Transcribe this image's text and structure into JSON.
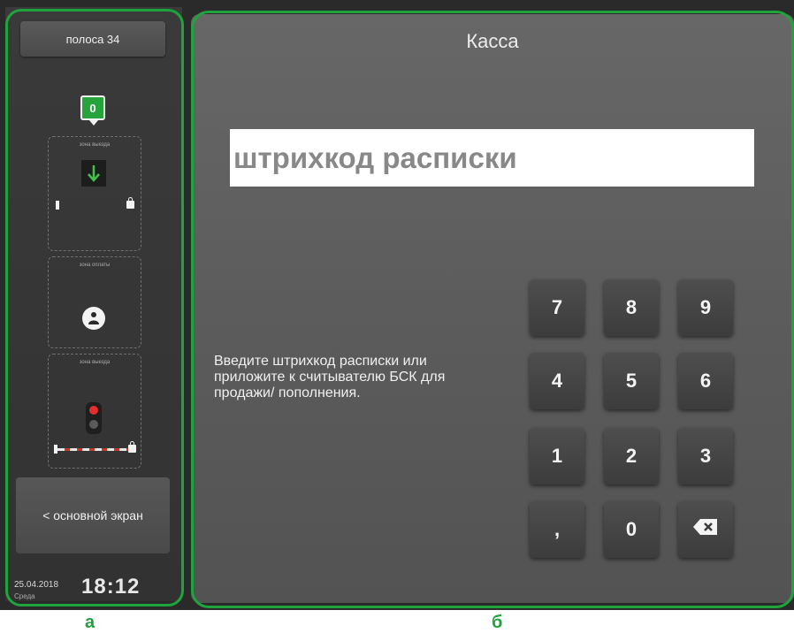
{
  "sidebar": {
    "lane_label": "полоса 34",
    "counter": "0",
    "zones": [
      "зона выезда",
      "зона оплаты",
      "зона выезда"
    ],
    "main_screen_label": "< основной экран",
    "date": "25.04.2018",
    "weekday": "Среда",
    "time": "18:12"
  },
  "panel": {
    "title": "Касса",
    "barcode_placeholder": "штрихкод расписки",
    "instruction": "Введите штрихкод расписки или приложите к считывателю БСК для продажи/ пополнения.",
    "keys": [
      "7",
      "8",
      "9",
      "4",
      "5",
      "6",
      "1",
      "2",
      "3",
      ",",
      "0"
    ]
  },
  "annotations": {
    "label_a": "а",
    "label_b": "б"
  },
  "colors": {
    "highlight": "#1fa33c",
    "badge": "#27a33b",
    "signal_red": "#e62d2d"
  }
}
